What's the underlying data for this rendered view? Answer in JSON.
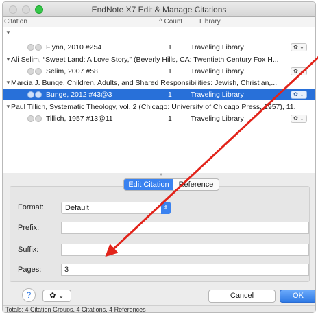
{
  "window": {
    "title": "EndNote X7 Edit & Manage Citations"
  },
  "columns": {
    "citation": "Citation",
    "count": "^ Count",
    "library": "Library"
  },
  "rows": [
    {
      "type": "group",
      "text": ""
    },
    {
      "type": "item",
      "citation": "Flynn, 2010 #254",
      "count": "1",
      "library": "Traveling Library"
    },
    {
      "type": "group",
      "text": "Ali Selim, “Sweet Land: A Love Story,” (Beverly Hills, CA: Twentieth Century Fox H..."
    },
    {
      "type": "item",
      "citation": "Selim, 2007 #58",
      "count": "1",
      "library": "Traveling Library"
    },
    {
      "type": "group",
      "text": "Marcia J. Bunge, Children, Adults, and Shared Responsibilities: Jewish, Christian,..."
    },
    {
      "type": "item",
      "citation": "Bunge, 2012 #43@3",
      "count": "1",
      "library": "Traveling Library",
      "selected": true
    },
    {
      "type": "group",
      "text": "Paul Tillich, Systematic Theology, vol. 2 (Chicago: University of Chicago Press, 1957), 11."
    },
    {
      "type": "item",
      "citation": "Tillich, 1957 #13@11",
      "count": "1",
      "library": "Traveling Library"
    }
  ],
  "tabs": {
    "edit_citation": "Edit Citation",
    "reference": "Reference"
  },
  "form": {
    "format_label": "Format:",
    "format_value": "Default",
    "prefix_label": "Prefix:",
    "prefix_value": "",
    "suffix_label": "Suffix:",
    "suffix_value": "",
    "pages_label": "Pages:",
    "pages_value": "3"
  },
  "footer": {
    "help": "?",
    "cancel": "Cancel",
    "ok": "OK",
    "status": "Totals: 4 Citation Groups, 4 Citations, 4 References"
  },
  "icons": {
    "gear": "gear-icon",
    "help": "help-icon",
    "disclosure": "disclosure-triangle-icon"
  },
  "colors": {
    "selection": "#2870d9",
    "accent": "#3a82f0",
    "annotation_arrow": "#e2231a"
  }
}
